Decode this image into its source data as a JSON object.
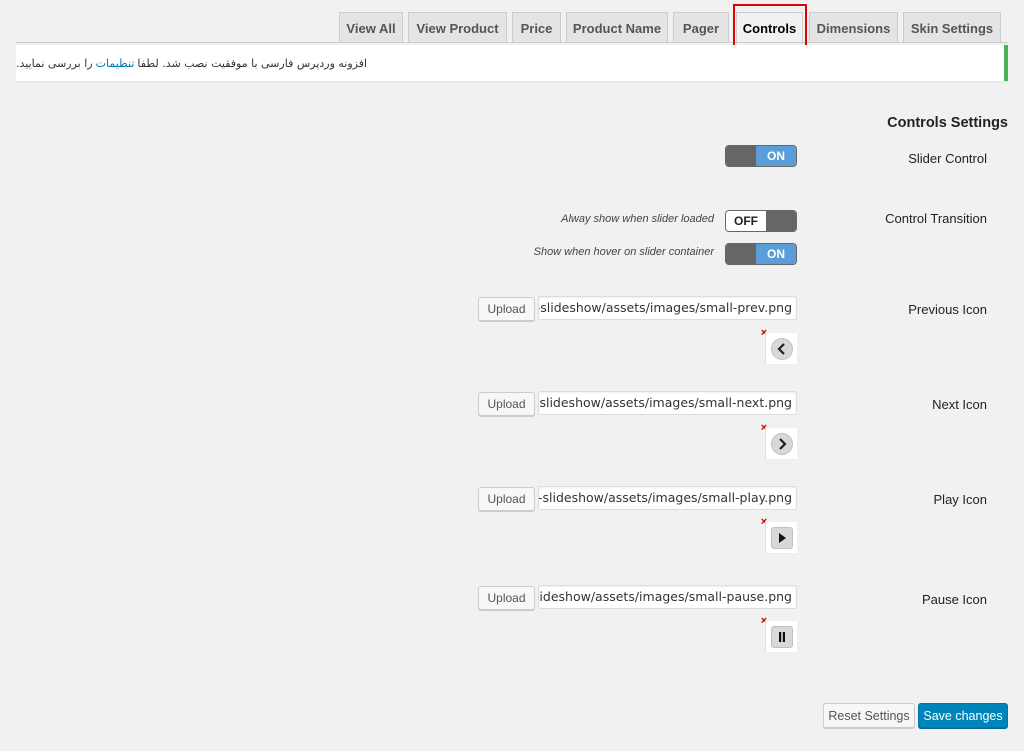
{
  "tabs": [
    {
      "label": "View All",
      "active": false
    },
    {
      "label": "View Product",
      "active": false
    },
    {
      "label": "Price",
      "active": false
    },
    {
      "label": "Product Name",
      "active": false
    },
    {
      "label": "Pager",
      "active": false
    },
    {
      "label": "Controls",
      "active": true
    },
    {
      "label": "Dimensions",
      "active": false
    },
    {
      "label": "Skin Settings",
      "active": false
    }
  ],
  "notice": {
    "text_before": "افزونه وردپرس فارسی با موفقیت نصب شد. لطفا",
    "link": "تنظیمات",
    "text_after": "را بررسی نمایید."
  },
  "section_title": "Controls Settings",
  "slider_control": {
    "label": "Slider Control",
    "state": "ON"
  },
  "control_transition": {
    "label": "Control Transition",
    "options": [
      {
        "label": "Alway show when slider loaded",
        "state": "OFF"
      },
      {
        "label": "Show when hover on slider container",
        "state": "ON"
      }
    ]
  },
  "icons": [
    {
      "label": "Previous Icon",
      "upload_label": "Upload",
      "path": "uct-slideshow/assets/images/small-prev.png",
      "remove": "×",
      "glyph": "chevron-left-icon"
    },
    {
      "label": "Next Icon",
      "upload_label": "Upload",
      "path": "uct-slideshow/assets/images/small-next.png",
      "remove": "×",
      "glyph": "chevron-right-icon"
    },
    {
      "label": "Play Icon",
      "upload_label": "Upload",
      "path": "uct-slideshow/assets/images/small-play.png",
      "remove": "×",
      "glyph": "play-icon"
    },
    {
      "label": "Pause Icon",
      "upload_label": "Upload",
      "path": "ct-slideshow/assets/images/small-pause.png",
      "remove": "×",
      "glyph": "pause-icon"
    }
  ],
  "footer": {
    "reset_label": "Reset Settings",
    "save_label": "Save changes"
  },
  "colors": {
    "accent": "#0085ba",
    "toggle_on": "#5b9dd9",
    "notice_border": "#46b450",
    "highlight": "#e00000"
  }
}
